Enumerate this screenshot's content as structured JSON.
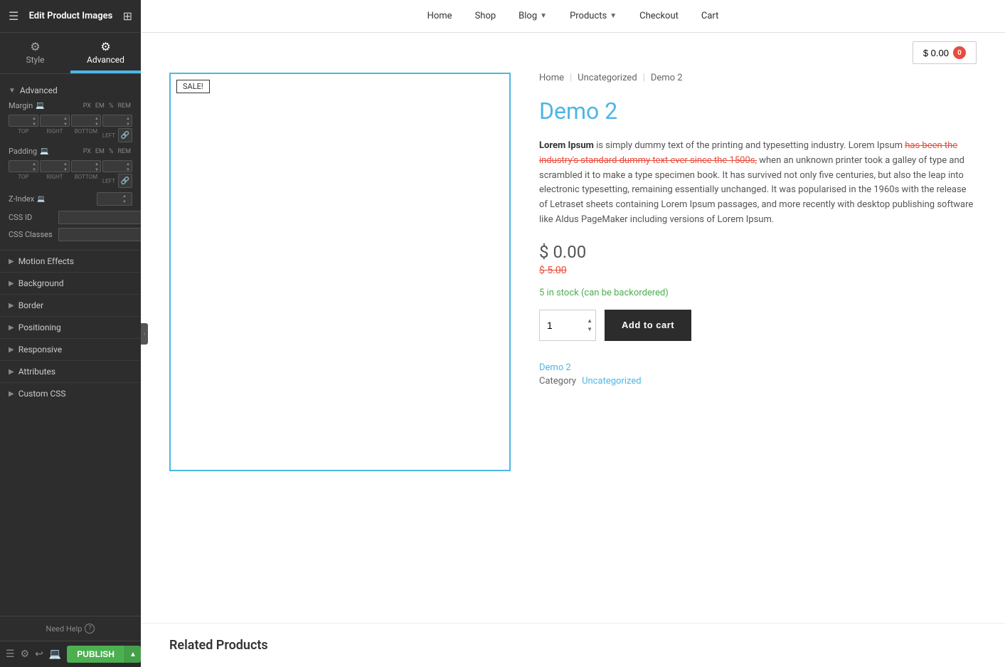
{
  "panel": {
    "title": "Edit Product Images",
    "tabs": [
      {
        "id": "style",
        "label": "Style",
        "icon": "⚙"
      },
      {
        "id": "advanced",
        "label": "Advanced",
        "icon": "⚙"
      }
    ],
    "active_tab": "advanced",
    "sections": {
      "advanced": {
        "label": "Advanced",
        "margin": {
          "label": "Margin",
          "units": [
            "PX",
            "EM",
            "%",
            "REM"
          ],
          "active_unit": "PX",
          "top": "",
          "right": "",
          "bottom": "",
          "left": ""
        },
        "padding": {
          "label": "Padding",
          "units": [
            "PX",
            "EM",
            "%",
            "REM"
          ],
          "active_unit": "PX",
          "top": "",
          "right": "",
          "bottom": "",
          "left": ""
        },
        "zindex": {
          "label": "Z-Index",
          "value": ""
        },
        "css_id": {
          "label": "CSS ID",
          "value": ""
        },
        "css_classes": {
          "label": "CSS Classes",
          "value": ""
        }
      }
    },
    "collapsible": [
      {
        "id": "motion-effects",
        "label": "Motion Effects"
      },
      {
        "id": "background",
        "label": "Background"
      },
      {
        "id": "border",
        "label": "Border"
      },
      {
        "id": "positioning",
        "label": "Positioning"
      },
      {
        "id": "responsive",
        "label": "Responsive"
      },
      {
        "id": "attributes",
        "label": "Attributes"
      },
      {
        "id": "custom-css",
        "label": "Custom CSS"
      }
    ],
    "footer": {
      "need_help": "Need Help",
      "publish_label": "PUBLISH"
    }
  },
  "nav": {
    "items": [
      {
        "id": "home",
        "label": "Home",
        "has_arrow": false
      },
      {
        "id": "shop",
        "label": "Shop",
        "has_arrow": false
      },
      {
        "id": "blog",
        "label": "Blog",
        "has_arrow": true
      },
      {
        "id": "products",
        "label": "Products",
        "has_arrow": true
      },
      {
        "id": "checkout",
        "label": "Checkout",
        "has_arrow": false
      },
      {
        "id": "cart",
        "label": "Cart",
        "has_arrow": false
      }
    ]
  },
  "cart": {
    "amount": "$ 0.00",
    "badge": "0"
  },
  "breadcrumb": {
    "items": [
      "Home",
      "Uncategorized",
      "Demo 2"
    ]
  },
  "product": {
    "title": "Demo 2",
    "sale_badge": "SALE!",
    "description": "Lorem Ipsum is simply dummy text of the printing and typesetting industry. Lorem Ipsum has been the industry's standard dummy text ever since the 1500s, when an unknown printer took a galley of type and scrambled it to make a type specimen book. It has survived not only five centuries, but also the leap into electronic typesetting, remaining essentially unchanged. It was popularised in the 1960s with the release of Letraset sheets containing Lorem Ipsum passages, and more recently with desktop publishing software like Aldus PageMaker including versions of Lorem Ipsum.",
    "price": "$ 0.00",
    "old_price": "$ 5.00",
    "stock": "5 in stock (can be backordered)",
    "quantity": "1",
    "add_to_cart_label": "Add to cart",
    "meta": {
      "name_label": "Demo 2",
      "category_label": "Category",
      "category_value": "Uncategorized"
    }
  },
  "related_products": {
    "title": "Related Products"
  }
}
